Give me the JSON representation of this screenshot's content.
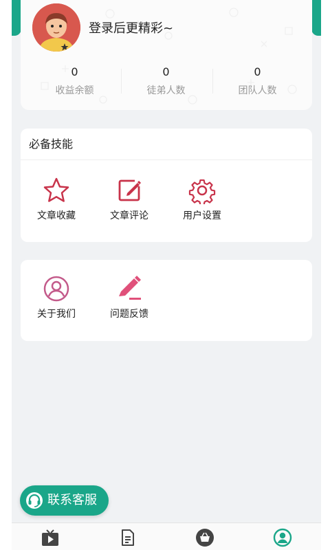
{
  "profile": {
    "login_prompt": "登录后更精彩~",
    "stats": [
      {
        "value": "0",
        "label": "收益余额"
      },
      {
        "value": "0",
        "label": "徒弟人数"
      },
      {
        "value": "0",
        "label": "团队人数"
      }
    ]
  },
  "skills_card": {
    "title": "必备技能",
    "items": [
      {
        "label": "文章收藏",
        "icon": "star-icon"
      },
      {
        "label": "文章评论",
        "icon": "edit-icon"
      },
      {
        "label": "用户设置",
        "icon": "gear-icon"
      }
    ]
  },
  "more_card": {
    "items": [
      {
        "label": "关于我们",
        "icon": "user-circle-icon"
      },
      {
        "label": "问题反馈",
        "icon": "pencil-icon"
      }
    ]
  },
  "service_button": {
    "label": "联系客服",
    "icon": "headset-icon"
  },
  "tabbar": {
    "tabs": [
      {
        "icon": "tv-play-icon",
        "active": false
      },
      {
        "icon": "document-icon",
        "active": false
      },
      {
        "icon": "basket-icon",
        "active": false
      },
      {
        "icon": "user-icon",
        "active": true
      }
    ]
  },
  "colors": {
    "accent": "#1aa689",
    "icon_red": "#c8334a",
    "icon_pink": "#e0507a"
  }
}
